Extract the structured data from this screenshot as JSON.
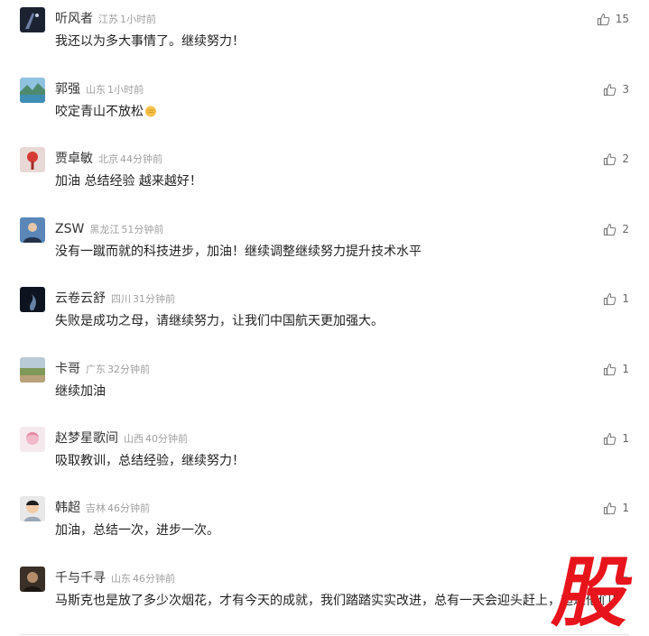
{
  "comments": [
    {
      "name": "听风者",
      "location": "江苏",
      "time": "1小时前",
      "text": "我还以为多大事情了。继续努力！",
      "likes": "15",
      "avatar": "dark-night-avatar"
    },
    {
      "name": "郭强",
      "location": "山东",
      "time": "1小时前",
      "text": "咬定青山不放松",
      "likes": "3",
      "avatar": "mountain-lake-avatar",
      "emoji": "fist-emoji"
    },
    {
      "name": "贾卓敏",
      "location": "北京",
      "time": "44分钟前",
      "text": "加油 总结经验 越来越好！",
      "likes": "2",
      "avatar": "red-lantern-avatar"
    },
    {
      "name": "ZSW",
      "location": "黑龙江",
      "time": "51分钟前",
      "text": "没有一蹴而就的科技进步，加油！继续调整继续努力提升技术水平",
      "likes": "2",
      "avatar": "person-blue-avatar"
    },
    {
      "name": "云卷云舒",
      "location": "四川",
      "time": "31分钟前",
      "text": "失败是成功之母，请继续努力，让我们中国航天更加强大。",
      "likes": "1",
      "avatar": "dark-smoke-avatar"
    },
    {
      "name": "卡哥",
      "location": "广东",
      "time": "32分钟前",
      "text": "继续加油",
      "likes": "1",
      "avatar": "field-landscape-avatar"
    },
    {
      "name": "赵梦星歌间",
      "location": "山西",
      "time": "40分钟前",
      "text": "吸取教训，总结经验，继续努力！",
      "likes": "1",
      "avatar": "pink-cartoon-avatar"
    },
    {
      "name": "韩超",
      "location": "吉林",
      "time": "46分钟前",
      "text": "加油，总结一次，进步一次。",
      "likes": "1",
      "avatar": "child-photo-avatar"
    },
    {
      "name": "千与千寻",
      "location": "山东",
      "time": "46分钟前",
      "text": "马斯克也是放了多少次烟花，才有今天的成就，我们踏踏实实改进，总有一天会迎头赶上，超过他们！",
      "likes": "",
      "avatar": "dark-portrait-avatar"
    }
  ],
  "watermark": {
    "text": "股",
    "color": "#e8141c"
  },
  "colors": {
    "name": "#333333",
    "meta": "#a0a0a0",
    "text": "#222222",
    "divider": "#e4e4e4"
  }
}
